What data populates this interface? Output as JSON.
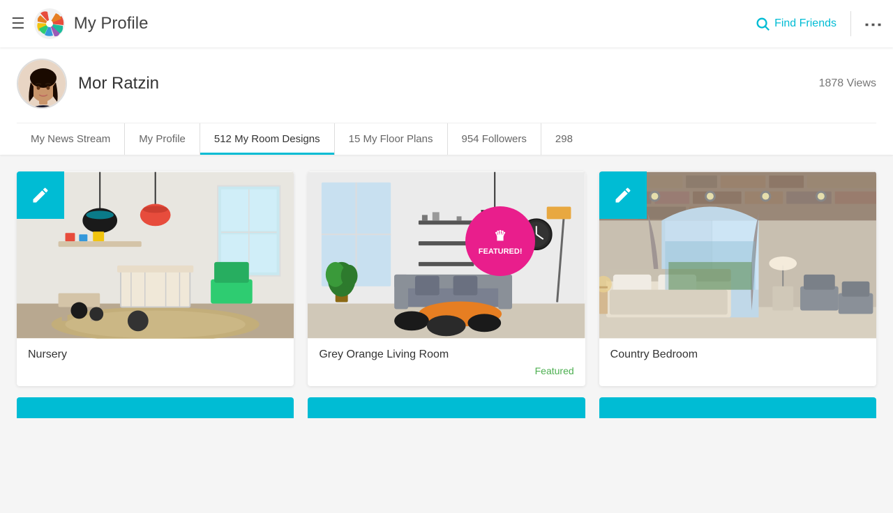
{
  "header": {
    "title": "My Profile",
    "find_friends_label": "Find Friends"
  },
  "profile": {
    "name": "Mor Ratzin",
    "views": "1878 Views"
  },
  "tabs": [
    {
      "id": "news",
      "label": "My News Stream",
      "active": false
    },
    {
      "id": "profile",
      "label": "My Profile",
      "active": false
    },
    {
      "id": "designs",
      "label": "512 My Room Designs",
      "active": true
    },
    {
      "id": "floorplans",
      "label": "15 My Floor Plans",
      "active": false
    },
    {
      "id": "followers",
      "label": "954 Followers",
      "active": false
    },
    {
      "id": "following",
      "label": "298",
      "active": false
    }
  ],
  "designs": [
    {
      "id": 1,
      "title": "Nursery",
      "featured": false,
      "featured_label": "",
      "has_edit": true
    },
    {
      "id": 2,
      "title": "Grey Orange Living Room",
      "featured": true,
      "featured_label": "Featured",
      "has_edit": false
    },
    {
      "id": 3,
      "title": "Country Bedroom",
      "featured": false,
      "featured_label": "",
      "has_edit": true
    }
  ],
  "featured_badge": {
    "icon": "♛",
    "text": "FEATURED!"
  }
}
